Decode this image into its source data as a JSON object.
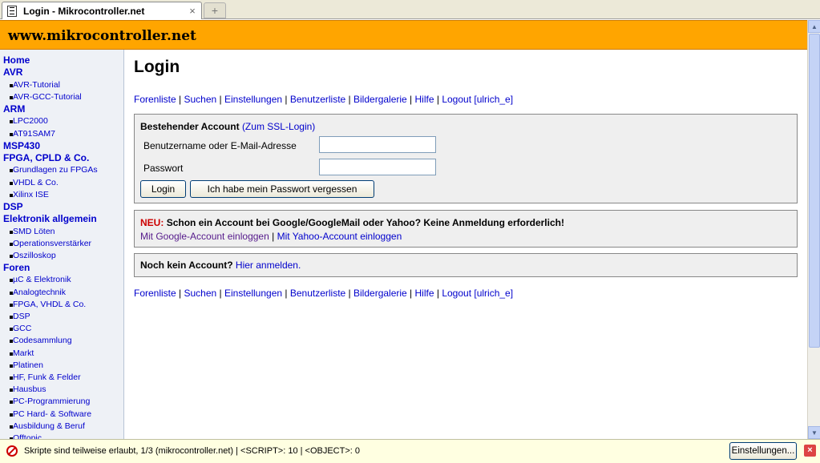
{
  "browser": {
    "tab_title": "Login - Mikrocontroller.net",
    "tab_close": "×",
    "new_tab": "+"
  },
  "site": {
    "title": "www.mikrocontroller.net"
  },
  "sidebar": {
    "items": [
      {
        "label": "Home",
        "level": 0
      },
      {
        "label": "AVR",
        "level": 0
      },
      {
        "label": "AVR-Tutorial",
        "level": 1
      },
      {
        "label": "AVR-GCC-Tutorial",
        "level": 1
      },
      {
        "label": "ARM",
        "level": 0
      },
      {
        "label": "LPC2000",
        "level": 1
      },
      {
        "label": "AT91SAM7",
        "level": 1
      },
      {
        "label": "MSP430",
        "level": 0
      },
      {
        "label": "FPGA, CPLD & Co.",
        "level": 0
      },
      {
        "label": "Grundlagen zu FPGAs",
        "level": 1
      },
      {
        "label": "VHDL & Co.",
        "level": 1
      },
      {
        "label": "Xilinx ISE",
        "level": 1
      },
      {
        "label": "DSP",
        "level": 0
      },
      {
        "label": "Elektronik allgemein",
        "level": 0
      },
      {
        "label": "SMD Löten",
        "level": 1
      },
      {
        "label": "Operationsverstärker",
        "level": 1
      },
      {
        "label": "Oszilloskop",
        "level": 1
      },
      {
        "label": "Foren",
        "level": 0
      },
      {
        "label": "µC & Elektronik",
        "level": 1
      },
      {
        "label": "Analogtechnik",
        "level": 1
      },
      {
        "label": "FPGA, VHDL & Co.",
        "level": 1
      },
      {
        "label": "DSP",
        "level": 1
      },
      {
        "label": "GCC",
        "level": 1
      },
      {
        "label": "Codesammlung",
        "level": 1
      },
      {
        "label": "Markt",
        "level": 1
      },
      {
        "label": "Platinen",
        "level": 1
      },
      {
        "label": "HF, Funk & Felder",
        "level": 1
      },
      {
        "label": "Hausbus",
        "level": 1
      },
      {
        "label": "PC-Programmierung",
        "level": 1
      },
      {
        "label": "PC Hard- & Software",
        "level": 1
      },
      {
        "label": "Ausbildung & Beruf",
        "level": 1
      },
      {
        "label": "Offtopic",
        "level": 1
      }
    ]
  },
  "main": {
    "title": "Login",
    "nav": {
      "links": [
        "Forenliste",
        "Suchen",
        "Einstellungen",
        "Benutzerliste",
        "Bildergalerie",
        "Hilfe",
        "Logout [ulrich_e]"
      ],
      "separator": " | "
    },
    "login_box": {
      "heading": "Bestehender Account",
      "ssl_link": "(Zum SSL-Login)",
      "username_label": "Benutzername oder E-Mail-Adresse",
      "username_value": "",
      "password_label": "Passwort",
      "password_value": "",
      "login_button": "Login",
      "forgot_button": "Ich habe mein Passwort vergessen"
    },
    "openid_box": {
      "new_label": "NEU:",
      "text": "Schon ein Account bei Google/GoogleMail oder Yahoo? Keine Anmeldung erforderlich!",
      "google_link": "Mit Google-Account einloggen",
      "separator": "|",
      "yahoo_link": "Mit Yahoo-Account einloggen"
    },
    "register_box": {
      "text": "Noch kein Account?",
      "link": "Hier anmelden."
    }
  },
  "statusbar": {
    "text": "Skripte sind teilweise erlaubt, 1/3 (mikrocontroller.net) | <SCRIPT>: 10 | <OBJECT>: 0",
    "settings_button": "Einstellungen...",
    "close": "×"
  },
  "colors": {
    "header_bg": "#ffa500",
    "link": "#0000cc",
    "new_red": "#cc0000",
    "box_bg": "#efefef"
  }
}
